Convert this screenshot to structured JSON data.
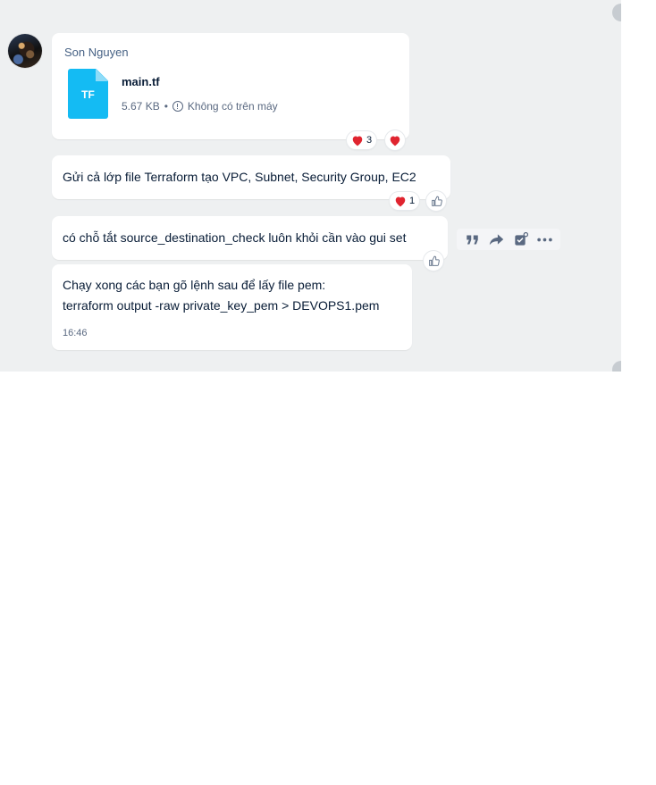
{
  "messages": {
    "file_message": {
      "sender": "Son Nguyen",
      "file_ext": "TF",
      "file_name": "main.tf",
      "file_size": "5.67 KB",
      "file_status": "Không có trên máy",
      "reaction_count": "3"
    },
    "text_1": {
      "text": "Gửi cả lớp file Terraform tạo VPC, Subnet, Security Group, EC2",
      "reaction_count": "1"
    },
    "text_2": {
      "text": "có chỗ tắt source_destination_check luôn khỏi cần vào gui set"
    },
    "text_3": {
      "line1": "Chạy xong các bạn gõ lệnh sau để lấy file pem:",
      "line2": "terraform output -raw private_key_pem > DEVOPS1.pem",
      "time": "16:46"
    }
  },
  "actions": [
    "quote-icon",
    "forward-icon",
    "add-task-icon",
    "more-icon"
  ],
  "colors": {
    "background": "#eef0f1",
    "bubble": "#ffffff",
    "file_icon": "#14bbf3",
    "heart": "#e0242f",
    "text_primary": "#081c36",
    "text_secondary": "#5a6981"
  }
}
